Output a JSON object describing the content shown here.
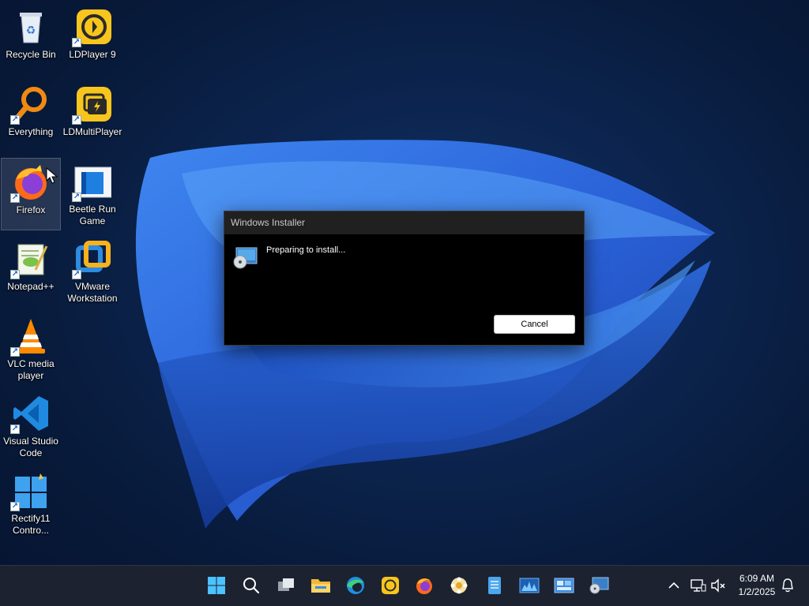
{
  "desktop": {
    "icons": [
      {
        "label": "Recycle Bin",
        "icon": "recycle-bin-icon",
        "shortcut": false
      },
      {
        "label": "LDPlayer 9",
        "icon": "ldplayer-icon",
        "shortcut": true
      },
      {
        "label": "Everything",
        "icon": "everything-search-icon",
        "shortcut": true
      },
      {
        "label": "LDMultiPlayer",
        "icon": "ldmultiplayer-icon",
        "shortcut": true
      },
      {
        "label": "Firefox",
        "icon": "firefox-icon",
        "shortcut": true,
        "selected": true
      },
      {
        "label": "Beetle Run Game",
        "icon": "beetle-run-game-icon",
        "shortcut": true
      },
      {
        "label": "Notepad++",
        "icon": "notepadpp-icon",
        "shortcut": true
      },
      {
        "label": "VMware Workstation",
        "icon": "vmware-icon",
        "shortcut": true
      },
      {
        "label": "VLC media player",
        "icon": "vlc-icon",
        "shortcut": true
      },
      {
        "label": "Visual Studio Code",
        "icon": "vscode-icon",
        "shortcut": true
      },
      {
        "label": "Rectify11 Contro...",
        "icon": "rectify11-icon",
        "shortcut": true
      }
    ]
  },
  "dialog": {
    "title": "Windows Installer",
    "message": "Preparing to install...",
    "cancel_label": "Cancel",
    "icon": "installer-disc-icon"
  },
  "taskbar": {
    "apps": [
      {
        "name": "start-button",
        "icon": "windows-logo-icon"
      },
      {
        "name": "search-button",
        "icon": "search-icon"
      },
      {
        "name": "task-view-button",
        "icon": "task-view-icon"
      },
      {
        "name": "file-explorer-button",
        "icon": "folder-icon"
      },
      {
        "name": "edge-button",
        "icon": "edge-icon"
      },
      {
        "name": "ldplayer-button",
        "icon": "ldplayer-icon"
      },
      {
        "name": "firefox-button",
        "icon": "firefox-icon"
      },
      {
        "name": "flower-app-button",
        "icon": "flower-icon"
      },
      {
        "name": "notepad-button",
        "icon": "notepad-icon"
      },
      {
        "name": "task-manager-button",
        "icon": "performance-chart-icon"
      },
      {
        "name": "control-panel-button",
        "icon": "control-panel-icon"
      },
      {
        "name": "installer-button",
        "icon": "installer-disc-icon"
      }
    ],
    "clock": {
      "time": "6:09 AM",
      "date": "1/2/2025"
    }
  },
  "colors": {
    "accent": "#1a73e8",
    "taskbar": "#1c2230",
    "dialog_bg": "#000000",
    "dialog_title_bg": "#202020"
  }
}
